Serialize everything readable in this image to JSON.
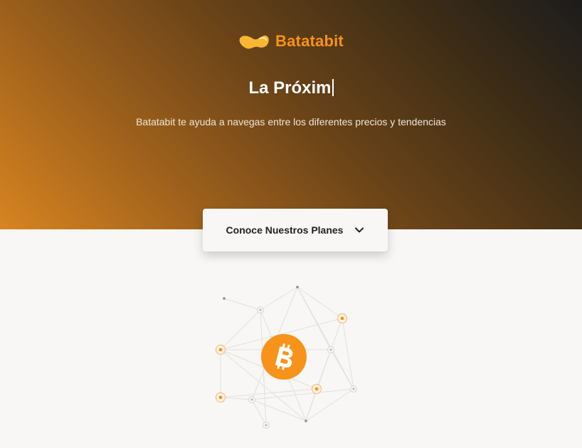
{
  "brand": {
    "name": "Batatabit",
    "logo_icon": "potato-logo-icon",
    "accent_color": "#f7931a"
  },
  "hero": {
    "headline": "La Próxim",
    "tagline": "Batatabit te ayuda a navegas entre los diferentes precios y tendencias",
    "gradient_colors": [
      "#1c1c1c",
      "#6a4318",
      "#d88420"
    ]
  },
  "plans_button": {
    "label": "Conoce Nuestros Planes",
    "icon": "chevron-down-icon"
  },
  "illustration": {
    "center_icon": "bitcoin-icon",
    "bitcoin_color": "#f7931a"
  }
}
